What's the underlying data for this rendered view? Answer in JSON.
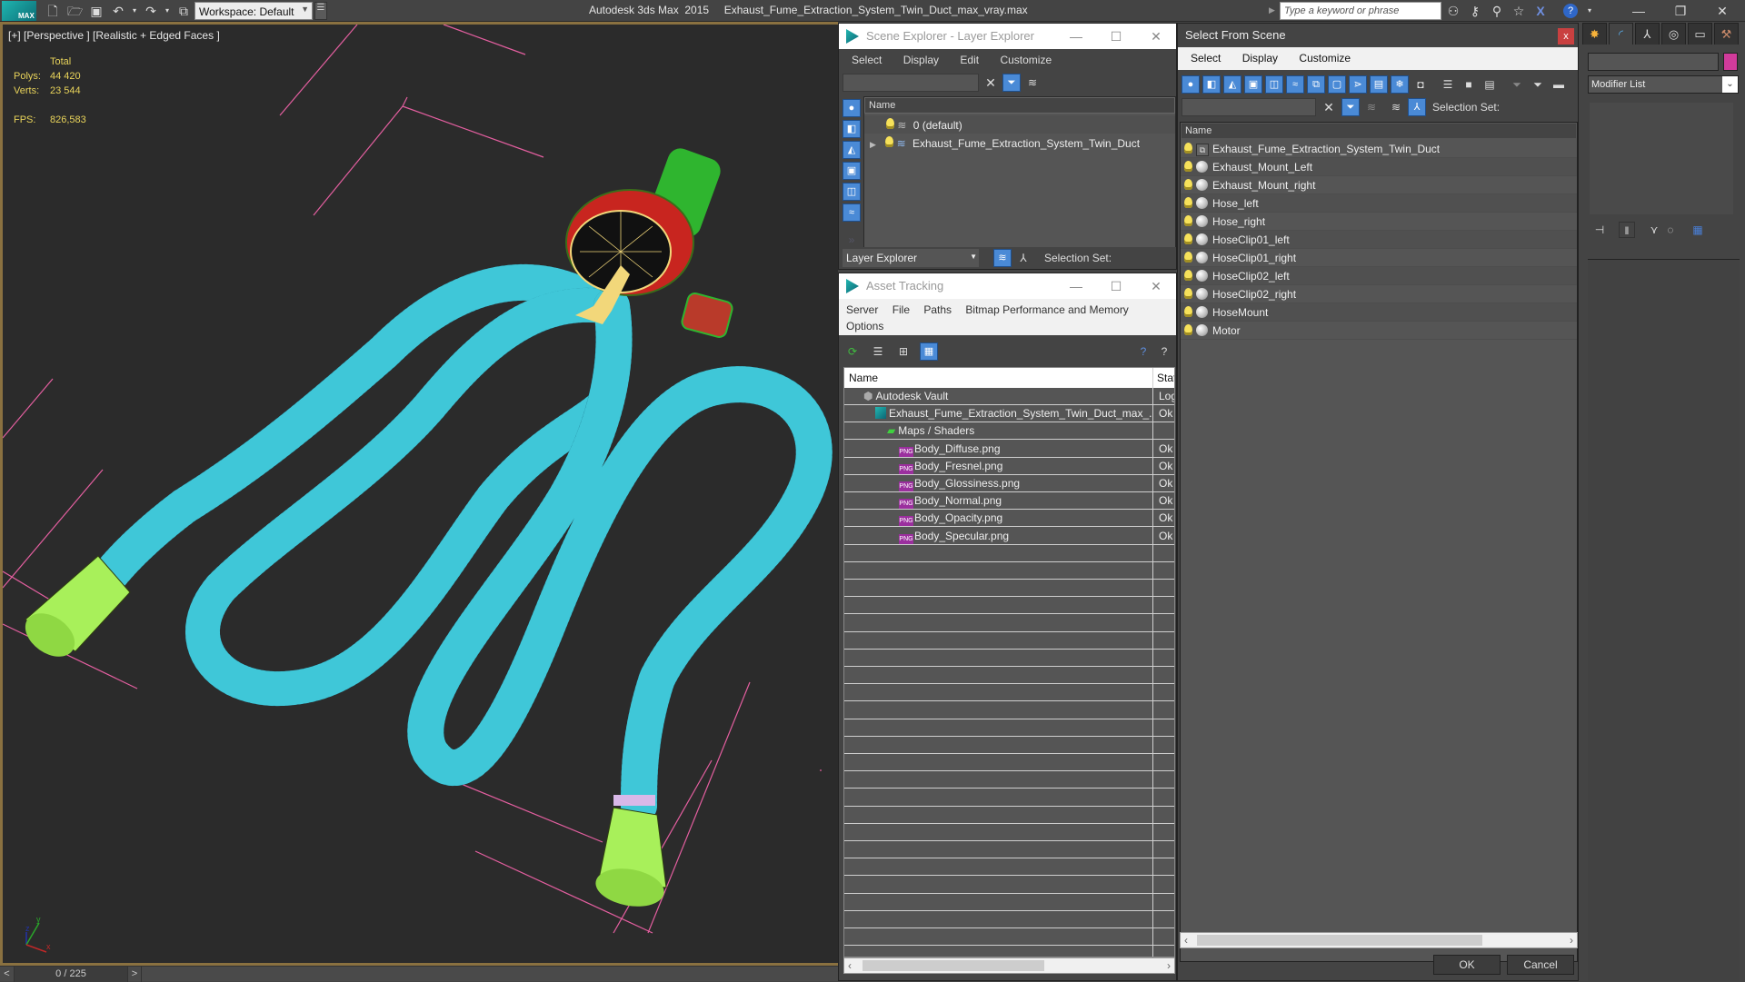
{
  "titlebar": {
    "logo_text": "MAX",
    "workspace_label": "Workspace: Default",
    "app_title": "Autodesk 3ds Max  2015     Exhaust_Fume_Extraction_System_Twin_Duct_max_vray.max",
    "search_placeholder": "Type a keyword or phrase",
    "icons": [
      "new-file-icon",
      "open-file-icon",
      "save-icon",
      "undo-icon",
      "redo-icon",
      "project-folder-icon"
    ],
    "sys_icons": [
      "binoculars-icon",
      "key-icon",
      "satellite-icon",
      "star-icon",
      "x-icon",
      "help-icon"
    ]
  },
  "viewport": {
    "label": "[+] [Perspective ] [Realistic + Edged Faces ]",
    "stats": {
      "total_label": "Total",
      "polys_label": "Polys:",
      "polys_value": "44 420",
      "verts_label": "Verts:",
      "verts_value": "23 544",
      "fps_label": "FPS:",
      "fps_value": "826,583"
    },
    "axis_labels": {
      "x": "x",
      "y": "y",
      "z": "z"
    },
    "colors": {
      "hose": "#3fc7d8",
      "motor_housing": "#c8251f",
      "motor": "#2fb52f",
      "nozzle": "#a8f05a",
      "connector": "#f2d77a",
      "grid": "#e45fa0",
      "viewport_border": "#8a7140"
    }
  },
  "timeline": {
    "prev": "<",
    "frame": "0 / 225",
    "next": ">"
  },
  "scene_explorer": {
    "title": "Scene Explorer - Layer Explorer",
    "menu": [
      "Select",
      "Display",
      "Edit",
      "Customize"
    ],
    "column_header": "Name",
    "rows": [
      {
        "label": "0 (default)",
        "expandable": false
      },
      {
        "label": "Exhaust_Fume_Extraction_System_Twin_Duct",
        "expandable": true
      }
    ],
    "side_tools": [
      "geometry-filter-icon",
      "shapes-filter-icon",
      "lights-filter-icon",
      "cameras-filter-icon",
      "helpers-filter-icon",
      "spacewarps-filter-icon"
    ],
    "mode_dropdown": "Layer Explorer",
    "selection_set_label": "Selection Set:"
  },
  "asset_tracking": {
    "title": "Asset Tracking",
    "menu": [
      "Server",
      "File",
      "Paths",
      "Bitmap Performance and Memory",
      "Options"
    ],
    "columns": [
      "Name",
      "Status"
    ],
    "column_header_visible": [
      "Name",
      "Stat"
    ],
    "rows": [
      {
        "name": "Autodesk Vault",
        "status": "Logged Out",
        "indent": 1,
        "icon": "vault-icon"
      },
      {
        "name": "Exhaust_Fume_Extraction_System_Twin_Duct_max_...",
        "status": "Ok",
        "indent": 2,
        "icon": "max-file-icon"
      },
      {
        "name": "Maps / Shaders",
        "status": "",
        "indent": 3,
        "icon": "maps-icon"
      },
      {
        "name": "Body_Diffuse.png",
        "status": "Ok",
        "indent": 4,
        "icon": "png-icon"
      },
      {
        "name": "Body_Fresnel.png",
        "status": "Ok",
        "indent": 4,
        "icon": "png-icon"
      },
      {
        "name": "Body_Glossiness.png",
        "status": "Ok",
        "indent": 4,
        "icon": "png-icon"
      },
      {
        "name": "Body_Normal.png",
        "status": "Ok",
        "indent": 4,
        "icon": "png-icon"
      },
      {
        "name": "Body_Opacity.png",
        "status": "Ok",
        "indent": 4,
        "icon": "png-icon"
      },
      {
        "name": "Body_Specular.png",
        "status": "Ok",
        "indent": 4,
        "icon": "png-icon"
      }
    ],
    "png_badge": "PNG"
  },
  "select_from_scene": {
    "title": "Select From Scene",
    "close": "x",
    "menu": [
      "Select",
      "Display",
      "Customize"
    ],
    "selection_set_label": "Selection Set:",
    "column_header": "Name",
    "rows": [
      {
        "label": "Exhaust_Fume_Extraction_System_Twin_Duct",
        "type": "group"
      },
      {
        "label": "Exhaust_Mount_Left",
        "type": "geometry"
      },
      {
        "label": "Exhaust_Mount_right",
        "type": "geometry"
      },
      {
        "label": "Hose_left",
        "type": "geometry"
      },
      {
        "label": "Hose_right",
        "type": "geometry"
      },
      {
        "label": "HoseClip01_left",
        "type": "geometry"
      },
      {
        "label": "HoseClip01_right",
        "type": "geometry"
      },
      {
        "label": "HoseClip02_left",
        "type": "geometry"
      },
      {
        "label": "HoseClip02_right",
        "type": "geometry"
      },
      {
        "label": "HoseMount",
        "type": "geometry"
      },
      {
        "label": "Motor",
        "type": "geometry"
      }
    ],
    "ok_label": "OK",
    "cancel_label": "Cancel"
  },
  "command_panel": {
    "tabs": [
      "create-tab",
      "modify-tab",
      "hierarchy-tab",
      "motion-tab",
      "display-tab",
      "utilities-tab"
    ],
    "active_tab": "modify-tab",
    "object_color": "#d13b9b",
    "modifier_list_label": "Modifier List"
  }
}
